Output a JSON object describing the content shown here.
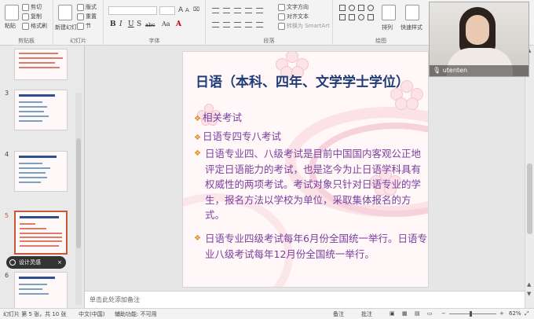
{
  "ribbon": {
    "clipboard": {
      "paste": "粘贴",
      "cut": "剪切",
      "copy": "复制",
      "format_painter": "格式刷",
      "label": "剪贴板"
    },
    "slides": {
      "new_slide": "新建幻灯片",
      "layout": "版式",
      "reset": "重置",
      "section": "节",
      "label": "幻灯片"
    },
    "font": {
      "label": "字体",
      "bold": "B",
      "italic": "I",
      "underline": "U",
      "strike": "S",
      "shadow": "abc",
      "grow": "A",
      "shrink": "A",
      "case": "Aa"
    },
    "paragraph": {
      "label": "段落",
      "text_direction": "文字方向",
      "align_text": "对齐文本",
      "smartart": "转换为 SmartArt"
    },
    "drawing": {
      "label": "绘图",
      "arrange": "排列",
      "quick_styles": "快速样式"
    }
  },
  "thumbnails": [
    {
      "number": "3"
    },
    {
      "number": "4"
    },
    {
      "number": "5",
      "active": true
    },
    {
      "number": "6"
    }
  ],
  "pip": {
    "label": "设计灵感",
    "close": "×"
  },
  "slide": {
    "title": "日语（本科、四年、文学学士学位）",
    "bullet1": "相关考试",
    "bullet2": "日语专四专八考试",
    "para1": "日语专业四、八级考试是目前中国国内客观公正地评定日语能力的考试，也是迄今为止日语学科具有权威性的两项考试。考试对象只针对日语专业的学生，报名方法以学校为单位，采取集体报名的方式。",
    "para2": "日语专业四级考试每年6月份全国统一举行。日语专业八级考试每年12月份全国统一举行。",
    "mark": "❖"
  },
  "notes": {
    "placeholder": "单击此处添加备注"
  },
  "status": {
    "slide_info": "幻灯片 第 5 张，共 10 张",
    "language": "中文(中国)",
    "accessibility": "辅助功能: 不可用",
    "notes_button": "备注",
    "comments_button": "批注",
    "zoom": "62%"
  },
  "webcam": {
    "name": "utenten"
  }
}
